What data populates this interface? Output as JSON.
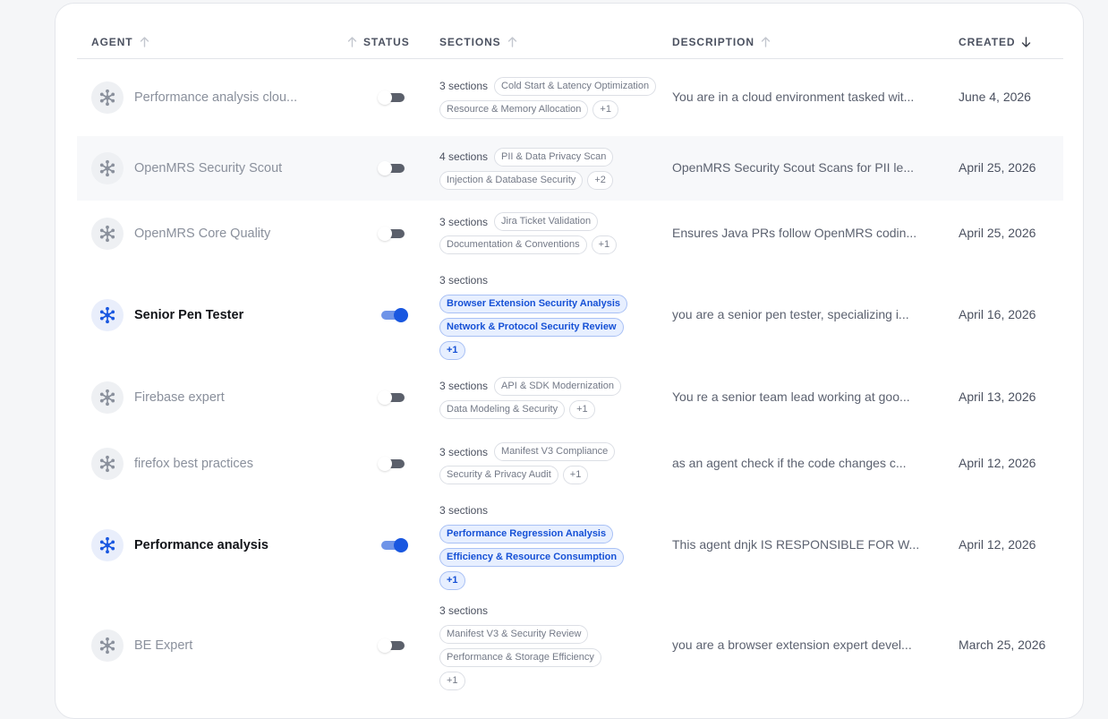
{
  "columns": {
    "agent": "AGENT",
    "status": "STATUS",
    "sections": "SECTIONS",
    "description": "DESCRIPTION",
    "created": "CREATED"
  },
  "rows": [
    {
      "name": "Performance analysis clou...",
      "enabled": false,
      "sections_label": "3 sections",
      "tags": [
        "Cold Start & Latency Optimization",
        "Resource & Memory Allocation",
        "+1"
      ],
      "description": "You are in a cloud environment tasked wit...",
      "created": "June 4, 2026"
    },
    {
      "name": "OpenMRS Security Scout",
      "enabled": false,
      "sections_label": "4 sections",
      "tags": [
        "PII & Data Privacy Scan",
        "Injection & Database Security",
        "+2"
      ],
      "description": "OpenMRS Security Scout Scans for PII le...",
      "created": "April 25, 2026"
    },
    {
      "name": "OpenMRS Core Quality",
      "enabled": false,
      "sections_label": "3 sections",
      "tags": [
        "Jira Ticket Validation",
        "Documentation & Conventions",
        "+1"
      ],
      "description": "Ensures Java PRs follow OpenMRS codin...",
      "created": "April 25, 2026"
    },
    {
      "name": "Senior Pen Tester",
      "enabled": true,
      "sections_label": "3 sections",
      "tags": [
        "Browser Extension Security Analysis",
        "Network & Protocol Security Review",
        "+1"
      ],
      "description": "you are a senior pen tester, specializing i...",
      "created": "April 16, 2026"
    },
    {
      "name": "Firebase expert",
      "enabled": false,
      "sections_label": "3 sections",
      "tags": [
        "API & SDK Modernization",
        "Data Modeling & Security",
        "+1"
      ],
      "description": "You re a senior team lead working at goo...",
      "created": "April 13, 2026"
    },
    {
      "name": "firefox best practices",
      "enabled": false,
      "sections_label": "3 sections",
      "tags": [
        "Manifest V3 Compliance",
        "Security & Privacy Audit",
        "+1"
      ],
      "description": "as an agent check if the code changes c...",
      "created": "April 12, 2026"
    },
    {
      "name": "Performance analysis",
      "enabled": true,
      "sections_label": "3 sections",
      "tags": [
        "Performance Regression Analysis",
        "Efficiency & Resource Consumption",
        "+1"
      ],
      "description": "This agent dnjk IS RESPONSIBLE FOR W...",
      "created": "April 12, 2026"
    },
    {
      "name": "BE Expert",
      "enabled": false,
      "sections_label": "3 sections",
      "tags": [
        "Manifest V3 & Security Review",
        "Performance & Storage Efficiency",
        "+1"
      ],
      "description": "you are a browser extension expert devel...",
      "created": "March 25, 2026"
    }
  ],
  "colors": {
    "accent": "#1957e0",
    "accent_soft": "#e7efff",
    "muted_text": "#8a909c",
    "border": "#e4e6eb"
  },
  "icons": {
    "agent": "network-nodes-icon",
    "sort_asc": "arrow-up-icon",
    "sort_desc": "arrow-down-icon"
  }
}
